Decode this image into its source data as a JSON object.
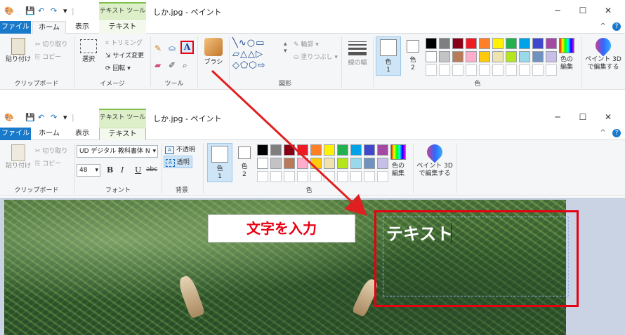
{
  "colors": {
    "file_tab": "#1979ca",
    "ctx_tab": "#dcefc8",
    "highlight_red": "#e60012",
    "arrow_red": "#e02020",
    "canvas_bg": "#c9d3e4"
  },
  "quick_access": {
    "customize_glyph": "▾",
    "separator": "|"
  },
  "window_controls": {
    "minimize": "─",
    "maximize": "☐",
    "close": "✕"
  },
  "help": {
    "collapse": "^",
    "help_glyph": "?"
  },
  "top_window": {
    "context_header": "テキスト ツール",
    "title": "しか.jpg - ペイント",
    "tabs": {
      "file": "ファイル",
      "home": "ホーム",
      "view": "表示",
      "text": "テキスト"
    },
    "clipboard": {
      "paste": "貼り付け",
      "cut": "切り取り",
      "copy": "コピー",
      "label": "クリップボード"
    },
    "image": {
      "select": "選択",
      "crop": "トリミング",
      "resize": "サイズ変更",
      "rotate": "回転",
      "label": "イメージ"
    },
    "tools": {
      "text_tool": "A",
      "label": "ツール"
    },
    "brush": {
      "label": "ブラシ"
    },
    "shapes": {
      "outline": "輪郭",
      "fill": "塗りつぶし",
      "label": "図形"
    },
    "size": {
      "label": "線の幅"
    },
    "color1": {
      "label_line1": "色",
      "label_line2": "1"
    },
    "color2": {
      "label_line1": "色",
      "label_line2": "2"
    },
    "edit_colors": {
      "line1": "色の",
      "line2": "編集"
    },
    "paint3d": {
      "line1": "ペイント 3D",
      "line2": "で編集する"
    },
    "colors_label": "色"
  },
  "bottom_window": {
    "context_header": "テキスト ツール",
    "title": "しか.jpg - ペイント",
    "tabs": {
      "file": "ファイル",
      "home": "ホーム",
      "view": "表示",
      "text": "テキスト"
    },
    "clipboard": {
      "paste": "貼り付け",
      "cut": "切り取り",
      "copy": "コピー",
      "label": "クリップボード"
    },
    "font": {
      "family": "UD デジタル 教科書体 N",
      "size": "48",
      "bold": "B",
      "italic": "I",
      "underline": "U",
      "strike": "abc",
      "label": "フォント"
    },
    "background": {
      "opaque": "不透明",
      "transparent": "透明",
      "label": "背景"
    },
    "color1": {
      "label_line1": "色",
      "label_line2": "1"
    },
    "color2": {
      "label_line1": "色",
      "label_line2": "2"
    },
    "edit_colors": {
      "line1": "色の",
      "line2": "編集"
    },
    "paint3d": {
      "line1": "ペイント 3D",
      "line2": "で編集する"
    },
    "colors_label": "色"
  },
  "palette": [
    "#000000",
    "#7f7f7f",
    "#880015",
    "#ed1c24",
    "#ff7f27",
    "#fff200",
    "#22b14c",
    "#00a2e8",
    "#3f48cc",
    "#a349a4",
    "#ffffff",
    "#c3c3c3",
    "#b97a57",
    "#ffaec9",
    "#ffc90e",
    "#efe4b0",
    "#b5e61d",
    "#99d9ea",
    "#7092be",
    "#c8bfe7"
  ],
  "annotation": {
    "callout_text": "文字を入力",
    "canvas_text": "テキスト"
  }
}
